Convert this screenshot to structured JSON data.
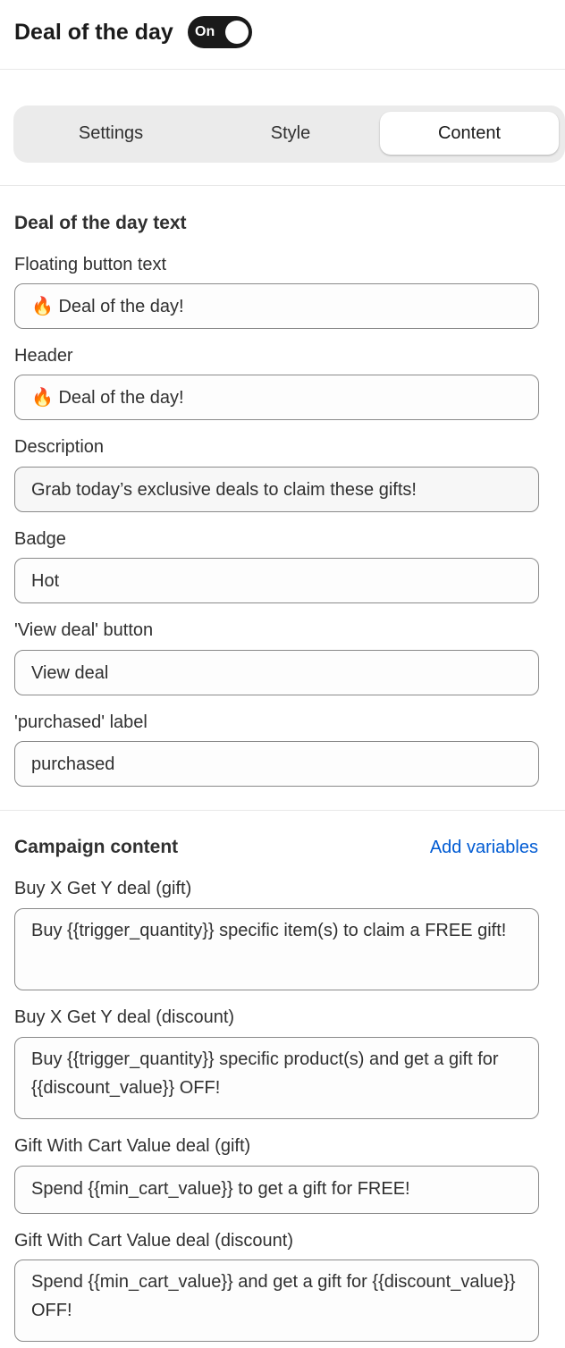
{
  "header": {
    "title": "Deal of the day",
    "toggle_label": "On"
  },
  "tabs": [
    {
      "label": "Settings",
      "selected": false
    },
    {
      "label": "Style",
      "selected": false
    },
    {
      "label": "Content",
      "selected": true
    }
  ],
  "deal_text": {
    "title": "Deal of the day text",
    "fields": [
      {
        "label": "Floating button text",
        "value": "🔥 Deal of the day!"
      },
      {
        "label": "Header",
        "value": "🔥 Deal of the day!"
      },
      {
        "label": "Description",
        "value": "Grab today’s exclusive deals to claim these gifts!"
      },
      {
        "label": "Badge",
        "value": "Hot"
      },
      {
        "label": "'View deal' button",
        "value": "View deal"
      },
      {
        "label": "'purchased' label",
        "value": "purchased"
      }
    ]
  },
  "campaign": {
    "title": "Campaign content",
    "add_variables": "Add variables",
    "fields": [
      {
        "label": "Buy X Get Y deal (gift)",
        "value": "Buy {{trigger_quantity}} specific item(s) to claim a FREE gift!"
      },
      {
        "label": "Buy X Get Y deal (discount)",
        "value": "Buy {{trigger_quantity}} specific product(s) and get a gift for {{discount_value}} OFF!"
      },
      {
        "label": "Gift With Cart Value deal (gift)",
        "value": "Spend {{min_cart_value}} to get a gift for FREE!"
      },
      {
        "label": "Gift With Cart Value deal (discount)",
        "value": "Spend {{min_cart_value}} and get a gift for {{discount_value}} OFF!"
      }
    ]
  }
}
